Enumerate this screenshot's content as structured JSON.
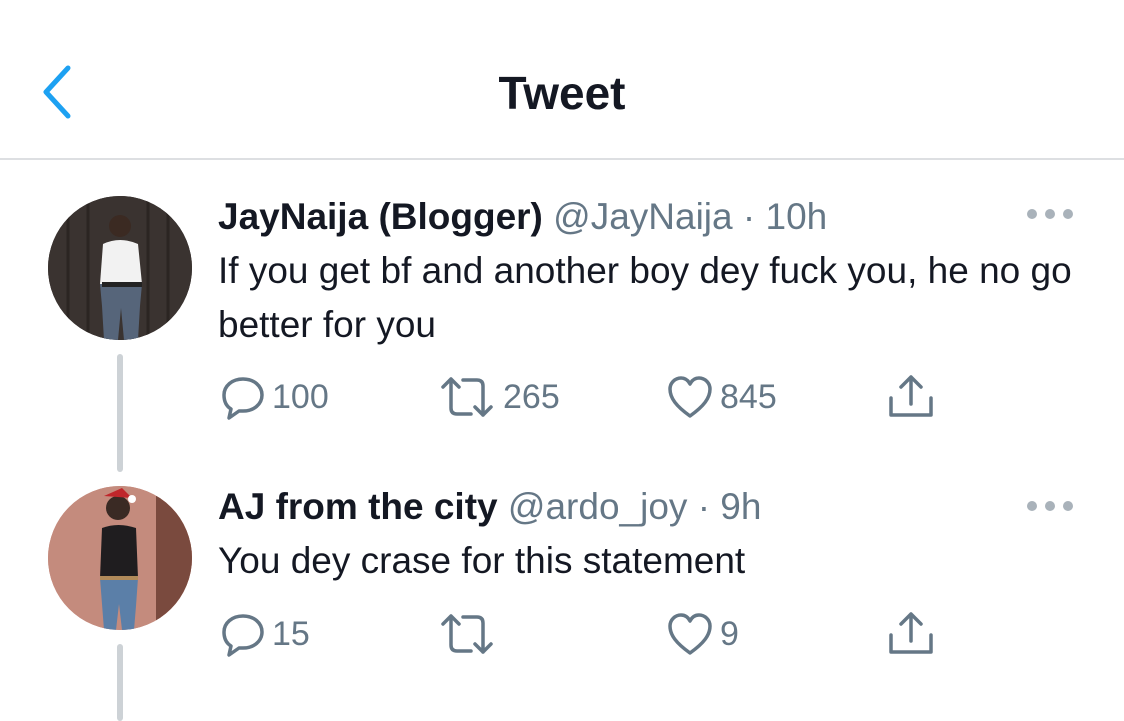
{
  "header": {
    "title": "Tweet",
    "back_icon": "chevron-left-icon",
    "accent": "#1da1f2"
  },
  "tweets": [
    {
      "name": "JayNaija (Blogger)",
      "handle": "@JayNaija",
      "separator": "·",
      "time": "10h",
      "text": "If you get bf and another boy dey fuck you, he no go better for you",
      "replies": "100",
      "retweets": "265",
      "likes": "845"
    },
    {
      "name": "AJ from the city",
      "handle": "@ardo_joy",
      "separator": "·",
      "time": "9h",
      "text": "You dey crase for this statement",
      "replies": "15",
      "retweets": "",
      "likes": "9"
    }
  ],
  "colors": {
    "secondary_text": "#657786",
    "icon": "#657786",
    "thread_line": "#cdd2d6"
  }
}
